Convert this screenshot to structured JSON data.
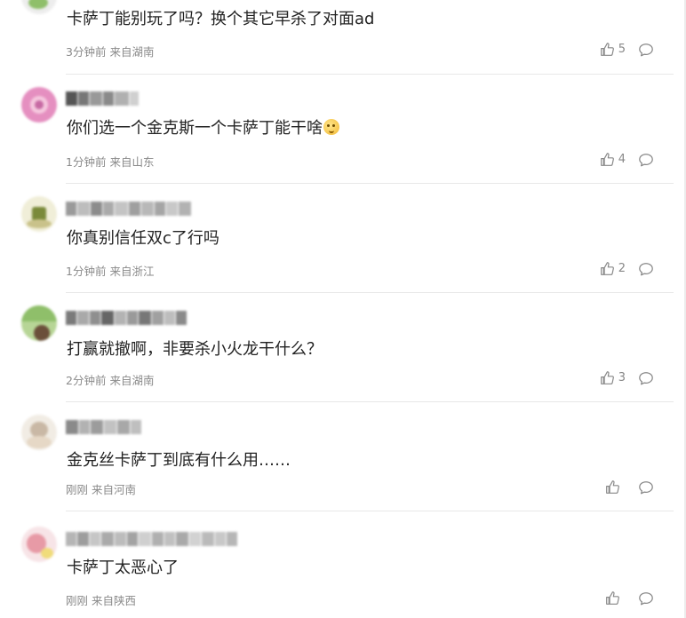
{
  "comments": [
    {
      "text": "卡萨丁能别玩了吗？换个其它早杀了对面ad",
      "time": "3分钟前",
      "location": "来自湖南",
      "likes": "5",
      "avatar_colors": [
        "#8fbf6a",
        "#d9d9d9"
      ],
      "name_colors": []
    },
    {
      "text": "你们选一个金克斯一个卡萨丁能干啥",
      "emoji": "thinking-face-emoji",
      "time": "1分钟前",
      "location": "来自山东",
      "likes": "4",
      "avatar_colors": [
        "#e58fc0",
        "#f5c8de",
        "#c76aa3"
      ],
      "name_colors": [
        "#555555",
        "#777777",
        "#999999",
        "#8a8a8a",
        "#b0b0b0"
      ]
    },
    {
      "text": "你真别信任双c了行吗",
      "time": "1分钟前",
      "location": "来自浙江",
      "likes": "2",
      "avatar_colors": [
        "#e9e6c8",
        "#7a8a3a",
        "#c9c28a"
      ],
      "name_colors": [
        "#9a9a9a",
        "#bdbdbd",
        "#8c8c8c",
        "#aaaaaa",
        "#c4c4c4",
        "#9f9f9f",
        "#b8b8b8",
        "#a5a5a5"
      ]
    },
    {
      "text": "打赢就撤啊，非要杀小火龙干什么？",
      "time": "2分钟前",
      "location": "来自湖南",
      "likes": "3",
      "avatar_colors": [
        "#8fbf6a",
        "#6b4f3a",
        "#b7d596"
      ],
      "name_colors": [
        "#7a7a7a",
        "#a9a9a9",
        "#8f8f8f",
        "#666666",
        "#b3b3b3",
        "#9a9a9a",
        "#777777",
        "#a0a0a0"
      ]
    },
    {
      "text": "金克丝卡萨丁到底有什么用……",
      "time": "刚刚",
      "location": "来自河南",
      "likes": "",
      "avatar_colors": [
        "#f1ece4",
        "#c9b8a5",
        "#e6d8c6"
      ],
      "name_colors": [
        "#8a8a8a",
        "#b2b2b2",
        "#9c9c9c",
        "#c2c2c2"
      ]
    },
    {
      "text": "卡萨丁太恶心了",
      "time": "刚刚",
      "location": "来自陕西",
      "likes": "",
      "avatar_colors": [
        "#f3d1d6",
        "#e79aa6",
        "#f0dc7a"
      ],
      "name_colors": [
        "#b5b5b5",
        "#9d9d9d",
        "#c6c6c6",
        "#aaaaaa",
        "#bcbcbc",
        "#a3a3a3",
        "#cfcfcf",
        "#b0b0b0"
      ]
    }
  ]
}
